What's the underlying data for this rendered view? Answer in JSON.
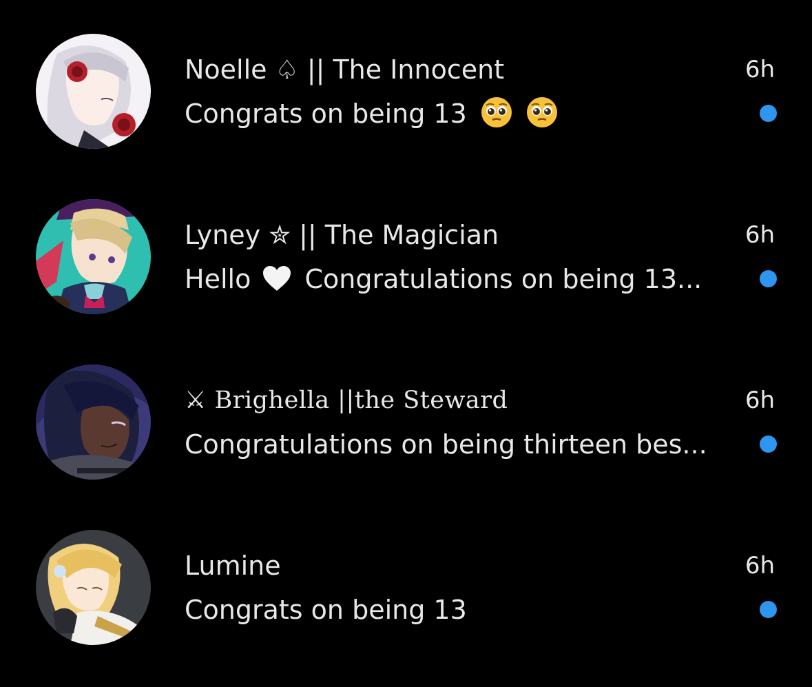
{
  "conversations": [
    {
      "name": "Noelle ♤ || The Innocent",
      "preview": "Congrats on being 13",
      "preview_emoji": [
        "pleading-face-icon",
        "pleading-face-icon"
      ],
      "time": "6h",
      "avatar": "noelle-avatar",
      "avatar_bg": "#f4f2f6",
      "unread": true
    },
    {
      "name": "Lyney ✮ || The Magician",
      "preview_before": "Hello",
      "preview_emoji": [
        "white-heart-icon"
      ],
      "preview_after": "Congratulations on being 13...",
      "time": "6h",
      "avatar": "lyney-avatar",
      "avatar_bg": "#2fbfb0",
      "unread": true
    },
    {
      "name": "⚔ Brighella ||the Steward",
      "preview": "Congratulations on being thirteen bes...",
      "time": "6h",
      "avatar": "brighella-avatar",
      "avatar_bg": "#3d3a7a",
      "unread": true
    },
    {
      "name": "Lumine",
      "preview": "Congrats on being 13",
      "time": "6h",
      "avatar": "lumine-avatar",
      "avatar_bg": "#3a3d42",
      "unread": true
    }
  ],
  "colors": {
    "background": "#000000",
    "text": "#e8e8e8",
    "unread_dot": "#2e95f0"
  }
}
